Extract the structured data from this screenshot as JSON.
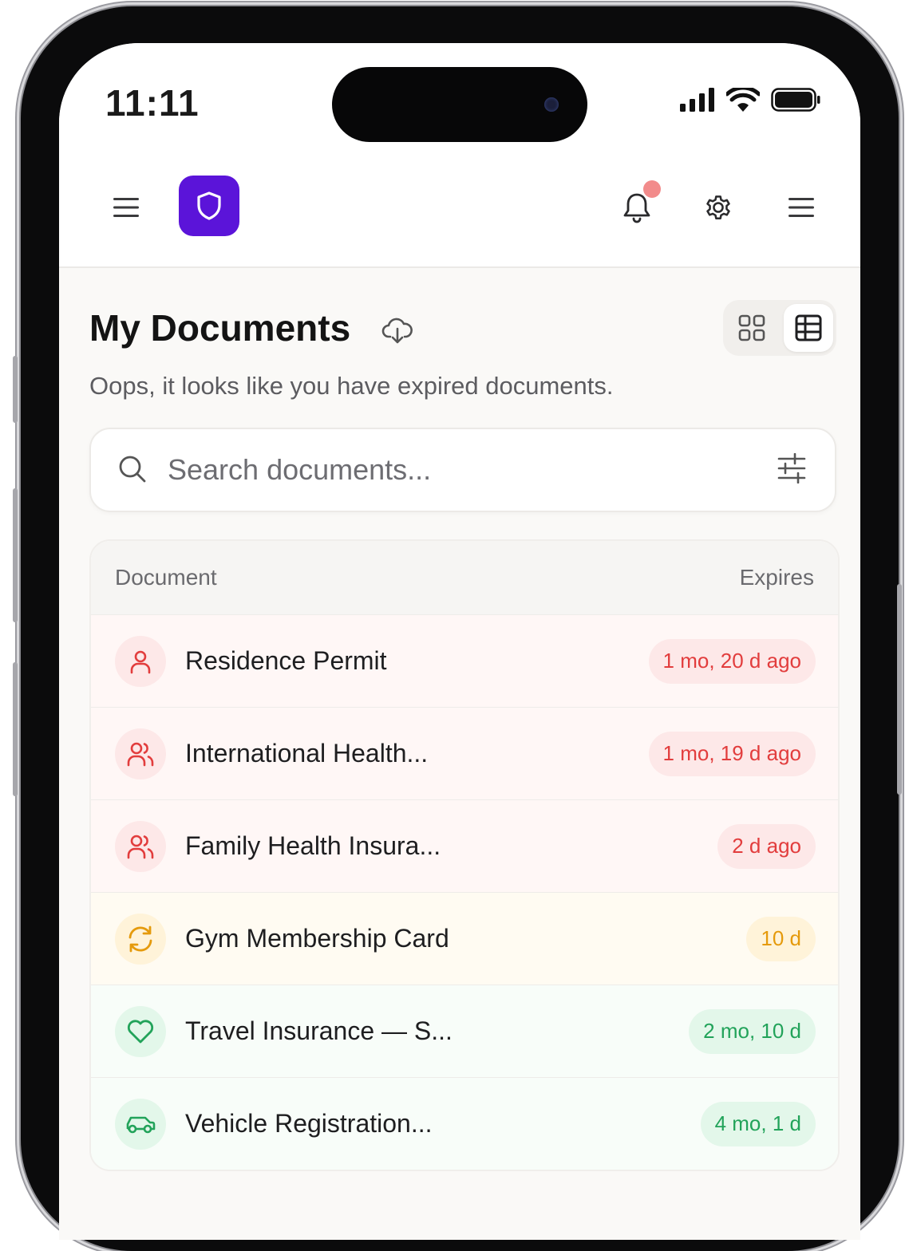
{
  "status_bar": {
    "time": "11:11"
  },
  "header": {
    "menu_icon": "menu-icon",
    "logo_icon": "shield-icon",
    "notifications_icon": "bell-icon",
    "settings_icon": "gear-icon",
    "more_icon": "menu-icon",
    "brand_color": "#5b14d9",
    "notification_dot_color": "#f28b8b"
  },
  "page": {
    "title": "My Documents",
    "subtitle": "Oops, it looks like you have expired documents.",
    "view_modes": [
      "grid",
      "table"
    ],
    "active_view": "table"
  },
  "search": {
    "placeholder": "Search documents..."
  },
  "table": {
    "columns": {
      "document": "Document",
      "expires": "Expires"
    },
    "rows": [
      {
        "name": "Residence Permit",
        "expires": "1 mo, 20 d ago",
        "icon": "user-icon",
        "status": "expired"
      },
      {
        "name": "International Health...",
        "expires": "1 mo, 19 d ago",
        "icon": "users-icon",
        "status": "expired"
      },
      {
        "name": "Family Health Insura...",
        "expires": "2 d ago",
        "icon": "users-icon",
        "status": "expired"
      },
      {
        "name": "Gym Membership Card",
        "expires": "10 d",
        "icon": "refresh-icon",
        "status": "expiring"
      },
      {
        "name": "Travel Insurance — S...",
        "expires": "2 mo, 10 d",
        "icon": "heart-icon",
        "status": "valid"
      },
      {
        "name": "Vehicle Registration...",
        "expires": "4 mo, 1 d",
        "icon": "car-icon",
        "status": "valid"
      }
    ]
  },
  "status_colors": {
    "expired": {
      "fg": "#e23d3d",
      "bg": "#fde8e8",
      "row": "#fff7f6"
    },
    "expiring": {
      "fg": "#e59a0c",
      "bg": "#fff3d9",
      "row": "#fffbf2"
    },
    "valid": {
      "fg": "#22a35a",
      "bg": "#e3f7ea",
      "row": "#f8fdf9"
    }
  }
}
